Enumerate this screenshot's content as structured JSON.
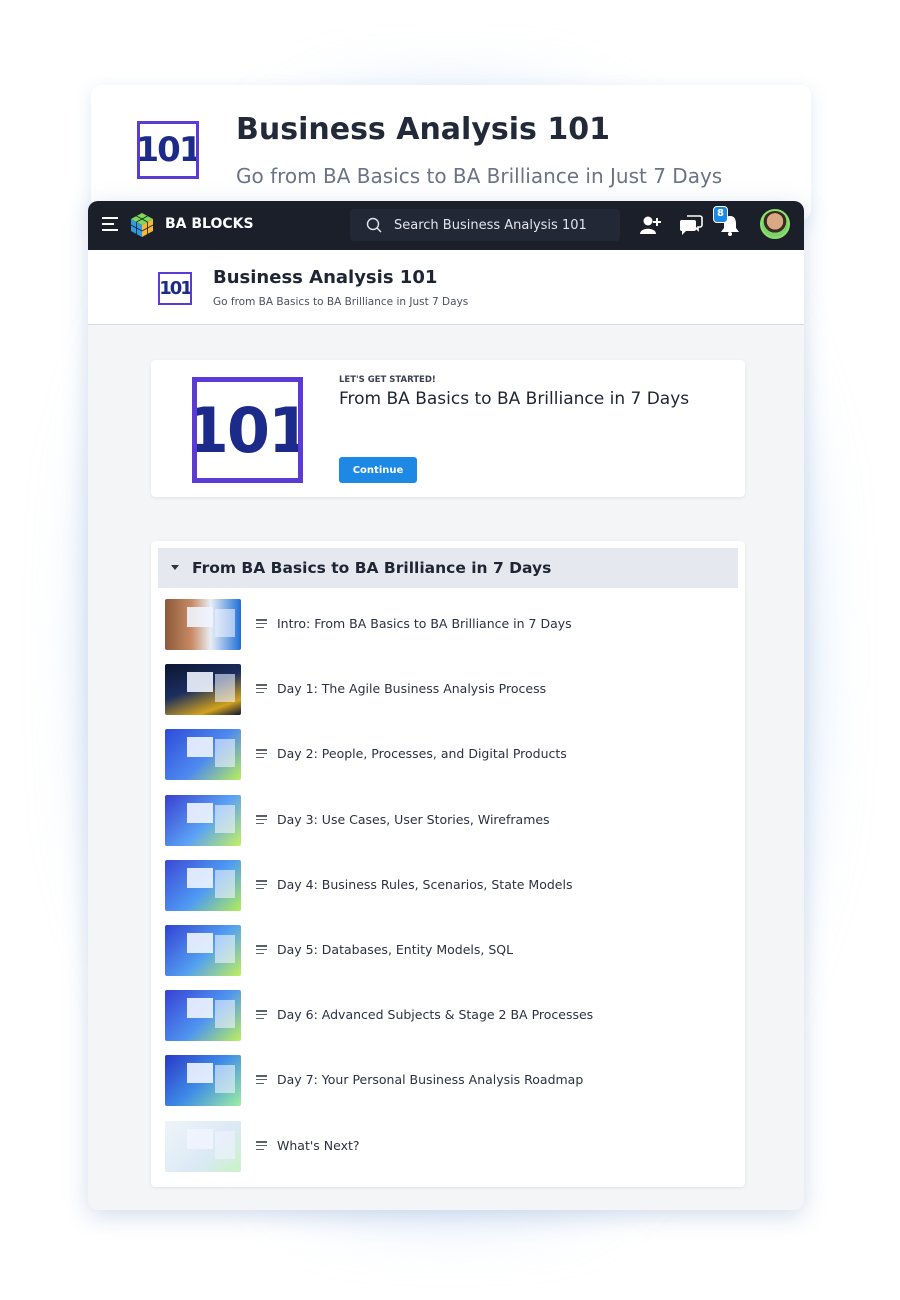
{
  "hero": {
    "title": "Business Analysis 101",
    "subtitle": "Go from BA Basics to BA Brilliance in Just 7 Days",
    "logo_text": "101"
  },
  "topbar": {
    "brand": "BA BLOCKS",
    "search_placeholder": "Search Business Analysis 101",
    "notification_count": "8",
    "icons": [
      "hamburger-icon",
      "cube-logo-icon",
      "search-icon",
      "add-user-icon",
      "chat-icon",
      "bell-icon",
      "avatar"
    ]
  },
  "course_header": {
    "logo_text": "101",
    "title": "Business Analysis 101",
    "subtitle": "Go from BA Basics to BA Brilliance in Just 7 Days"
  },
  "start_card": {
    "logo_text": "101",
    "kicker": "LET'S GET STARTED!",
    "title": "From BA Basics to BA Brilliance in 7 Days",
    "button_label": "Continue"
  },
  "section": {
    "title": "From BA Basics to BA Brilliance in 7 Days",
    "lessons": [
      {
        "label": "Intro: From BA Basics to BA Brilliance in 7 Days"
      },
      {
        "label": "Day 1: The Agile Business Analysis Process"
      },
      {
        "label": "Day 2: People, Processes, and Digital Products"
      },
      {
        "label": "Day 3: Use Cases, User Stories, Wireframes"
      },
      {
        "label": "Day 4: Business Rules, Scenarios, State Models"
      },
      {
        "label": "Day 5: Databases, Entity Models, SQL"
      },
      {
        "label": "Day 6: Advanced Subjects & Stage 2 BA Processes"
      },
      {
        "label": "Day 7: Your Personal Business Analysis Roadmap"
      },
      {
        "label": "What's Next?"
      }
    ]
  },
  "colors": {
    "topbar": "#1b1f2a",
    "accent": "#1e88e5",
    "logo_border": "#5b3bd6",
    "section_bg": "#e5e8ef"
  }
}
